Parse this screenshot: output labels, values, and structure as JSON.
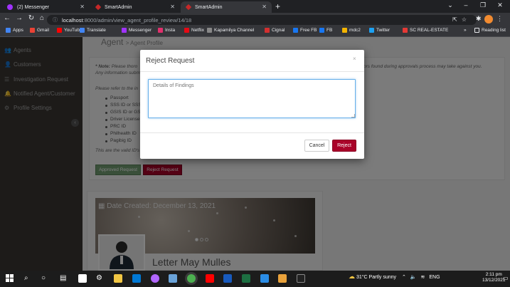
{
  "browser": {
    "tabs": [
      {
        "title": "(2) Messenger",
        "icon": "messenger-icon",
        "active": false
      },
      {
        "title": "SmartAdmin",
        "icon": "smartadmin-icon",
        "active": false
      },
      {
        "title": "SmartAdmin",
        "icon": "smartadmin-icon",
        "active": true
      }
    ],
    "new_tab": "+",
    "url_host": "localhost",
    "url_path": ":8000/admin/view_agent_profile_review/14/18",
    "bookmarks": [
      {
        "label": "Apps",
        "color": "#4285f4"
      },
      {
        "label": "Gmail",
        "color": "#ea4335"
      },
      {
        "label": "YouTube",
        "color": "#ff0000"
      },
      {
        "label": "Translate",
        "color": "#4285f4"
      },
      {
        "label": "Messenger",
        "color": "#a033ff"
      },
      {
        "label": "Insta",
        "color": "#e1306c"
      },
      {
        "label": "Netflix",
        "color": "#e50914"
      },
      {
        "label": "Kapamilya Channel",
        "color": "#888888"
      },
      {
        "label": "Cignal",
        "color": "#d32f2f"
      },
      {
        "label": "Free FB",
        "color": "#1877f2"
      },
      {
        "label": "FB",
        "color": "#1877f2"
      },
      {
        "label": "mdc2",
        "color": "#f4b400"
      },
      {
        "label": "Twitter",
        "color": "#1da1f2"
      },
      {
        "label": "SC REAL-ESTATE",
        "color": "#e53935"
      }
    ],
    "more_bookmarks": "»",
    "reading_list": "Reading list"
  },
  "sidebar": {
    "items": [
      {
        "label": "Agents",
        "icon": "users-icon"
      },
      {
        "label": "Customers",
        "icon": "user-icon"
      },
      {
        "label": "Investigation Request",
        "icon": "list-icon"
      },
      {
        "label": "Notified Agent/Customer",
        "icon": "bell-icon"
      },
      {
        "label": "Profile Settings",
        "icon": "gear-icon"
      }
    ]
  },
  "page": {
    "title": "Agent",
    "subtitle": "> Agent Profile",
    "note_label": "* Note:",
    "note_text": "Please thoro",
    "note_text_right": "ors found during approvals process may take against you.",
    "note_line2": "Any information subm",
    "refer_text": "Please refer to the in",
    "ids": [
      "Passport",
      "SSS ID or SSS",
      "GSIS ID or GS",
      "Driver License",
      "PRC ID",
      "Philhealth ID",
      "Pagibig ID"
    ],
    "valid_text": "This are the valid ID's",
    "approve_label": "Approved Request",
    "reject_label": "Reject Request",
    "date_created": "Date Created: December 13, 2021",
    "agent_name": "Letter May Mulles"
  },
  "modal": {
    "title": "Reject Request",
    "close": "×",
    "textarea_placeholder": "Details of Findings",
    "cancel_label": "Cancel",
    "reject_label": "Reject"
  },
  "taskbar": {
    "weather": "31°C  Partly sunny",
    "language": "ENG",
    "time": "2:11 pm",
    "date": "13/12/2021"
  }
}
